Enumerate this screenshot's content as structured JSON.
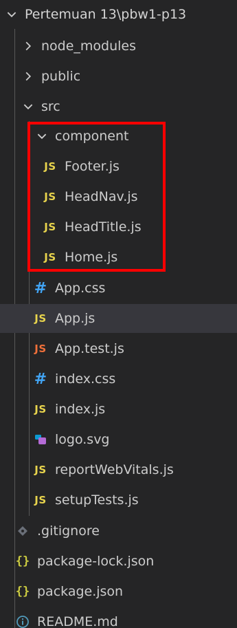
{
  "explorer": {
    "root": {
      "label": "Pertemuan 13\\pbw1-p13",
      "expanded": true
    },
    "node_modules": {
      "label": "node_modules",
      "expanded": false
    },
    "public": {
      "label": "public",
      "expanded": false
    },
    "src": {
      "label": "src",
      "expanded": true
    },
    "component": {
      "label": "component",
      "expanded": true
    },
    "component_files": [
      {
        "label": "Footer.js",
        "icon": "javascript-file-icon"
      },
      {
        "label": "HeadNav.js",
        "icon": "javascript-file-icon"
      },
      {
        "label": "HeadTitle.js",
        "icon": "javascript-file-icon"
      },
      {
        "label": "Home.js",
        "icon": "javascript-file-icon"
      }
    ],
    "src_files": [
      {
        "label": "App.css",
        "icon": "css-file-icon"
      },
      {
        "label": "App.js",
        "icon": "javascript-file-icon",
        "selected": true
      },
      {
        "label": "App.test.js",
        "icon": "javascript-test-file-icon"
      },
      {
        "label": "index.css",
        "icon": "css-file-icon"
      },
      {
        "label": "index.js",
        "icon": "javascript-file-icon"
      },
      {
        "label": "logo.svg",
        "icon": "svg-file-icon"
      },
      {
        "label": "reportWebVitals.js",
        "icon": "javascript-file-icon"
      },
      {
        "label": "setupTests.js",
        "icon": "javascript-file-icon"
      }
    ],
    "root_files": [
      {
        "label": ".gitignore",
        "icon": "git-file-icon"
      },
      {
        "label": "package-lock.json",
        "icon": "json-file-icon"
      },
      {
        "label": "package.json",
        "icon": "json-file-icon"
      },
      {
        "label": "README.md",
        "icon": "info-file-icon"
      }
    ],
    "icon_text": {
      "js": "JS",
      "css": "#",
      "json": "{}"
    },
    "colors": {
      "background": "#252526",
      "selected_row": "#37373d",
      "js_icon": "#e8d44d",
      "js_test_icon": "#f0703a",
      "css_icon": "#42a5f5",
      "json_icon": "#cbcb41",
      "highlight_border": "#ff0000"
    }
  }
}
